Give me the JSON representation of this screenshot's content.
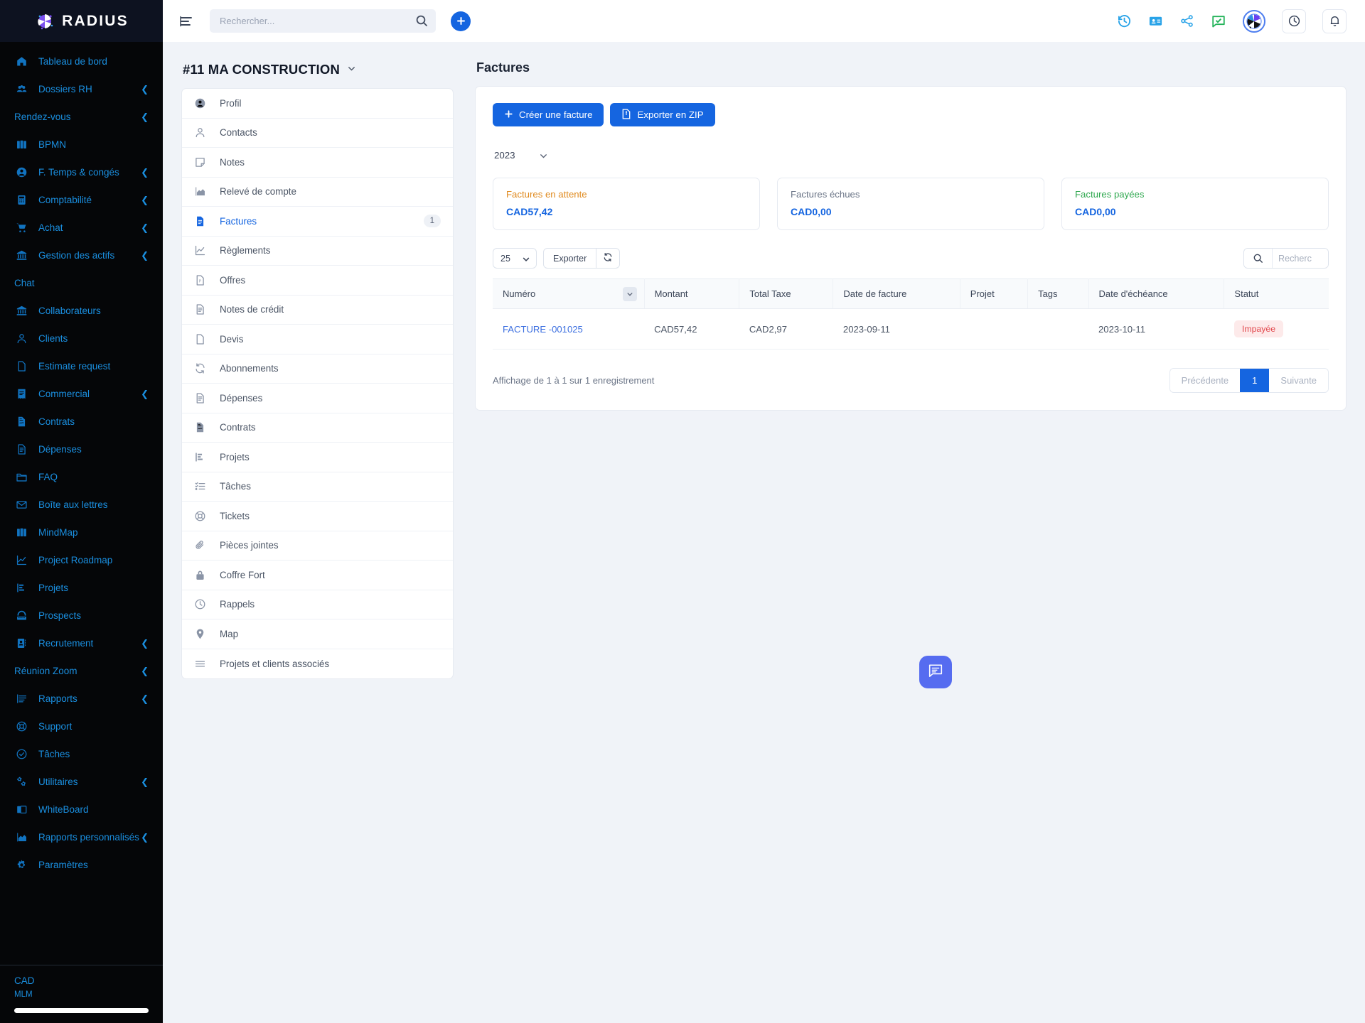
{
  "brand": {
    "name": "RADIUS",
    "logo_icon": "radius-logo-icon"
  },
  "sidebar": {
    "currency": "CAD",
    "company": "MLM",
    "items": [
      {
        "label": "Tableau de bord",
        "icon": "home-icon",
        "expandable": false
      },
      {
        "label": "Dossiers RH",
        "icon": "users-icon",
        "expandable": true
      },
      {
        "label": "Rendez-vous",
        "icon": "none",
        "expandable": true
      },
      {
        "label": "BPMN",
        "icon": "book-icon",
        "expandable": false
      },
      {
        "label": "F. Temps & congés",
        "icon": "user-circle-icon",
        "expandable": true
      },
      {
        "label": "Comptabilité",
        "icon": "calculator-icon",
        "expandable": true
      },
      {
        "label": "Achat",
        "icon": "cart-icon",
        "expandable": true
      },
      {
        "label": "Gestion des actifs",
        "icon": "bank-icon",
        "expandable": true
      },
      {
        "label": "Chat",
        "icon": "none",
        "expandable": false
      },
      {
        "label": "Collaborateurs",
        "icon": "bank-icon",
        "expandable": false
      },
      {
        "label": "Clients",
        "icon": "person-icon",
        "expandable": false
      },
      {
        "label": "Estimate request",
        "icon": "file-icon",
        "expandable": false
      },
      {
        "label": "Commercial",
        "icon": "receipt-icon",
        "expandable": true
      },
      {
        "label": "Contrats",
        "icon": "contract-icon",
        "expandable": false
      },
      {
        "label": "Dépenses",
        "icon": "doc-lines-icon",
        "expandable": false
      },
      {
        "label": "FAQ",
        "icon": "folder-icon",
        "expandable": false
      },
      {
        "label": "Boîte aux lettres",
        "icon": "mail-icon",
        "expandable": false
      },
      {
        "label": "MindMap",
        "icon": "book-icon",
        "expandable": false
      },
      {
        "label": "Project Roadmap",
        "icon": "chart-line-icon",
        "expandable": false
      },
      {
        "label": "Projets",
        "icon": "projects-icon",
        "expandable": false
      },
      {
        "label": "Prospects",
        "icon": "phone-icon",
        "expandable": false
      },
      {
        "label": "Recrutement",
        "icon": "id-card-icon",
        "expandable": true
      },
      {
        "label": "Réunion Zoom",
        "icon": "none",
        "expandable": true
      },
      {
        "label": "Rapports",
        "icon": "report-icon",
        "expandable": true
      },
      {
        "label": "Support",
        "icon": "lifebuoy-icon",
        "expandable": false
      },
      {
        "label": "Tâches",
        "icon": "check-circle-icon",
        "expandable": false
      },
      {
        "label": "Utilitaires",
        "icon": "gears-icon",
        "expandable": true
      },
      {
        "label": "WhiteBoard",
        "icon": "layers-icon",
        "expandable": false
      },
      {
        "label": "Rapports personnalisés",
        "icon": "chart-area-icon",
        "expandable": true
      },
      {
        "label": "Paramètres",
        "icon": "gear-icon",
        "expandable": false
      }
    ]
  },
  "topbar": {
    "menu_icon": "hamburger-icon",
    "search": {
      "placeholder": "Rechercher...",
      "value": "",
      "icon": "search-icon"
    },
    "add_label": "+",
    "right_icons": [
      "history-icon",
      "contact-card-icon",
      "share-icon",
      "chat-check-icon",
      "avatar-icon",
      "clock-icon",
      "bell-icon"
    ]
  },
  "entity": {
    "title": "#11 MA CONSTRUCTION",
    "caret_icon": "chevron-down-icon",
    "menu": [
      {
        "label": "Profil",
        "icon": "user-circle-icon",
        "active": false,
        "badge": ""
      },
      {
        "label": "Contacts",
        "icon": "person-icon",
        "active": false,
        "badge": ""
      },
      {
        "label": "Notes",
        "icon": "note-icon",
        "active": false,
        "badge": ""
      },
      {
        "label": "Relevé de compte",
        "icon": "chart-area-icon",
        "active": false,
        "badge": ""
      },
      {
        "label": "Factures",
        "icon": "invoice-icon",
        "active": true,
        "badge": "1"
      },
      {
        "label": "Règlements",
        "icon": "chart-line-icon",
        "active": false,
        "badge": ""
      },
      {
        "label": "Offres",
        "icon": "file-p-icon",
        "active": false,
        "badge": ""
      },
      {
        "label": "Notes de crédit",
        "icon": "doc-lines-icon",
        "active": false,
        "badge": ""
      },
      {
        "label": "Devis",
        "icon": "file-icon",
        "active": false,
        "badge": ""
      },
      {
        "label": "Abonnements",
        "icon": "refresh-icon",
        "active": false,
        "badge": ""
      },
      {
        "label": "Dépenses",
        "icon": "doc-lines-icon",
        "active": false,
        "badge": ""
      },
      {
        "label": "Contrats",
        "icon": "contract-icon",
        "active": false,
        "badge": ""
      },
      {
        "label": "Projets",
        "icon": "projects-icon",
        "active": false,
        "badge": ""
      },
      {
        "label": "Tâches",
        "icon": "checklist-icon",
        "active": false,
        "badge": ""
      },
      {
        "label": "Tickets",
        "icon": "lifebuoy-icon",
        "active": false,
        "badge": ""
      },
      {
        "label": "Pièces jointes",
        "icon": "paperclip-icon",
        "active": false,
        "badge": ""
      },
      {
        "label": "Coffre Fort",
        "icon": "lock-icon",
        "active": false,
        "badge": ""
      },
      {
        "label": "Rappels",
        "icon": "clock-icon",
        "active": false,
        "badge": ""
      },
      {
        "label": "Map",
        "icon": "map-pin-icon",
        "active": false,
        "badge": ""
      },
      {
        "label": "Projets et clients associés",
        "icon": "list-icon",
        "active": false,
        "badge": ""
      }
    ]
  },
  "invoices": {
    "page_title": "Factures",
    "create_label": "Créer une facture",
    "export_zip_label": "Exporter en ZIP",
    "year_selected": "2023",
    "year_options": [
      "2023"
    ],
    "stats": [
      {
        "label": "Factures en attente",
        "value": "CAD57,42",
        "color": "#e08a1e"
      },
      {
        "label": "Factures échues",
        "value": "CAD0,00",
        "color": "#6b7587"
      },
      {
        "label": "Factures payées",
        "value": "CAD0,00",
        "color": "#2fa84f"
      }
    ],
    "page_length": "25",
    "page_length_options": [
      "25"
    ],
    "export_label": "Exporter",
    "refresh_icon": "refresh-icon",
    "table_search": {
      "placeholder": "Recherc",
      "value": "",
      "icon": "search-icon"
    },
    "columns": [
      "Numéro",
      "Montant",
      "Total Taxe",
      "Date de facture",
      "Projet",
      "Tags",
      "Date d'échéance",
      "Statut"
    ],
    "rows": [
      {
        "numero": "FACTURE -001025",
        "montant": "CAD57,42",
        "total_taxe": "CAD2,97",
        "date_facture": "2023-09-11",
        "projet": "",
        "tags": "",
        "date_echeance": "2023-10-11",
        "statut": "Impayée"
      }
    ],
    "footer_info": "Affichage de 1 à 1 sur 1 enregistrement",
    "pager": {
      "prev": "Précédente",
      "current": "1",
      "next": "Suivante"
    }
  },
  "chat_fab": {
    "icon": "chat-bubble-icon"
  },
  "colors": {
    "accent": "#1565e0",
    "sidebar_bg": "#050608",
    "sidebar_text": "#1a8fe0",
    "danger": "#e2484d"
  }
}
